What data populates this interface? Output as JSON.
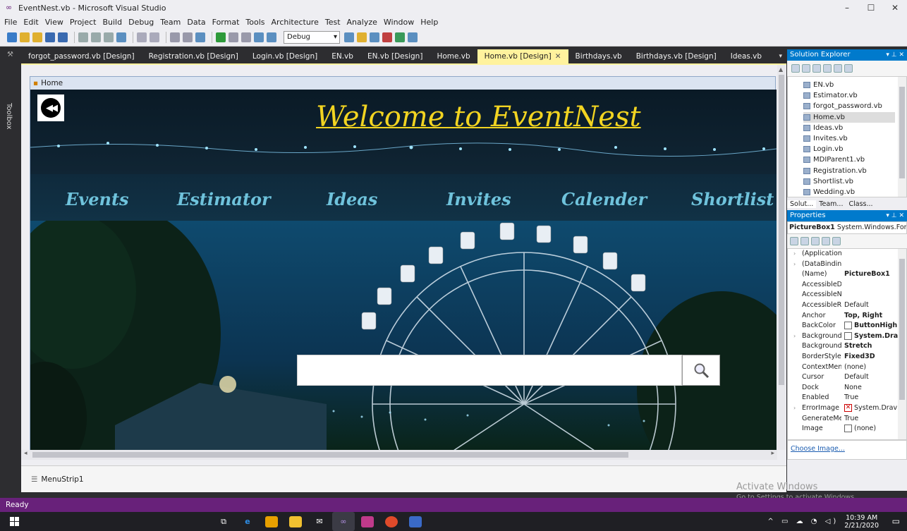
{
  "window": {
    "title": "EventNest.vb - Microsoft Visual Studio",
    "min": "–",
    "max": "☐",
    "close": "✕"
  },
  "menu": [
    "File",
    "Edit",
    "View",
    "Project",
    "Build",
    "Debug",
    "Team",
    "Data",
    "Format",
    "Tools",
    "Architecture",
    "Test",
    "Analyze",
    "Window",
    "Help"
  ],
  "toolbar": {
    "config": "Debug"
  },
  "toolbox": {
    "label": "Toolbox"
  },
  "tabs": [
    {
      "label": "forgot_password.vb [Design]"
    },
    {
      "label": "Registration.vb [Design]"
    },
    {
      "label": "Login.vb [Design]"
    },
    {
      "label": "EN.vb"
    },
    {
      "label": "EN.vb [Design]"
    },
    {
      "label": "Home.vb"
    },
    {
      "label": "Home.vb [Design]",
      "active": true
    },
    {
      "label": "Birthdays.vb"
    },
    {
      "label": "Birthdays.vb [Design]"
    },
    {
      "label": "Ideas.vb"
    }
  ],
  "form": {
    "title": "Home",
    "welcome": "Welcome to EventNest",
    "nav": [
      "Events",
      "Estimator",
      "Ideas",
      "Invites",
      "Calender",
      "Shortlist"
    ],
    "search_value": ""
  },
  "component_tray": {
    "item": "MenuStrip1"
  },
  "solution_explorer": {
    "title": "Solution Explorer",
    "items": [
      "EN.vb",
      "Estimator.vb",
      "forgot_password.vb",
      "Home.vb",
      "Ideas.vb",
      "Invites.vb",
      "Login.vb",
      "MDIParent1.vb",
      "Registration.vb",
      "Shortlist.vb",
      "Wedding.vb"
    ],
    "selected": "Home.vb",
    "bottom_tabs": [
      "Solut...",
      "Team...",
      "Class..."
    ]
  },
  "properties": {
    "title": "Properties",
    "object": "PictureBox1",
    "object_type": "System.Windows.Forı",
    "rows": [
      {
        "name": "(ApplicationS",
        "value": "",
        "expand": true
      },
      {
        "name": "(DataBinding",
        "value": "",
        "expand": true
      },
      {
        "name": "(Name)",
        "value": "PictureBox1",
        "bold": true
      },
      {
        "name": "AccessibleDe",
        "value": ""
      },
      {
        "name": "AccessibleNa",
        "value": ""
      },
      {
        "name": "AccessibleRol",
        "value": "Default"
      },
      {
        "name": "Anchor",
        "value": "Top, Right",
        "bold": true
      },
      {
        "name": "BackColor",
        "value": "ButtonHigh",
        "bold": true,
        "swatch": "blank"
      },
      {
        "name": "BackgroundIn",
        "value": "System.Dra",
        "bold": true,
        "swatch": "img",
        "expand": true
      },
      {
        "name": "BackgroundIn",
        "value": "Stretch",
        "bold": true
      },
      {
        "name": "BorderStyle",
        "value": "Fixed3D",
        "bold": true
      },
      {
        "name": "ContextMenu",
        "value": "(none)"
      },
      {
        "name": "Cursor",
        "value": "Default"
      },
      {
        "name": "Dock",
        "value": "None"
      },
      {
        "name": "Enabled",
        "value": "True"
      },
      {
        "name": "ErrorImage",
        "value": "System.Drav",
        "swatch": "err",
        "expand": true
      },
      {
        "name": "GenerateMen",
        "value": "True"
      },
      {
        "name": "Image",
        "value": "(none)",
        "swatch": "blank"
      }
    ],
    "choose_link": "Choose Image..."
  },
  "watermark": {
    "line1": "Activate Windows",
    "line2": "Go to Settings to activate Windows."
  },
  "status": "Ready",
  "clock": {
    "time": "10:39 AM",
    "date": "2/21/2020"
  },
  "colors": {
    "accent": "#007acc",
    "status": "#68217a",
    "active_tab": "#fff29d",
    "welcome": "#f2d421",
    "nav": "#6fc3dc"
  }
}
